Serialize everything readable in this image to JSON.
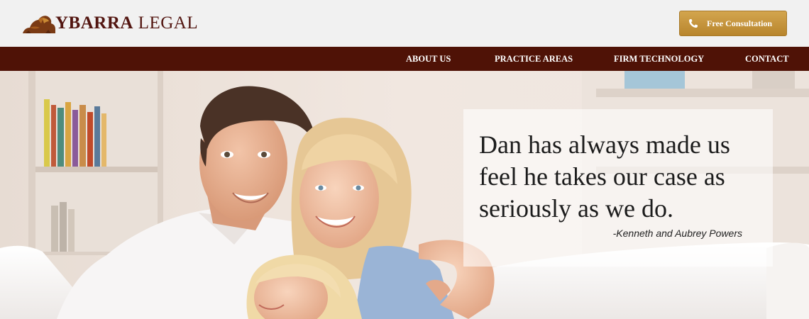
{
  "header": {
    "logo_strong": "YBARRA",
    "logo_light": "LEGAL",
    "logo_icon": "lion-icon",
    "cta": {
      "label": "Free Consultation",
      "icon": "phone-icon"
    }
  },
  "nav": {
    "items": [
      {
        "label": "ABOUT US"
      },
      {
        "label": "PRACTICE AREAS"
      },
      {
        "label": "FIRM TECHNOLOGY"
      },
      {
        "label": "CONTACT"
      }
    ]
  },
  "hero": {
    "quote": "Dan has always made us feel he takes our case as seriously as we do.",
    "author": "-Kenneth and Aubrey Powers"
  },
  "colors": {
    "brand": "#521510",
    "nav_bg": "#4f1206",
    "button_gold": "#c6963e",
    "header_bg": "#f1f1f1"
  }
}
